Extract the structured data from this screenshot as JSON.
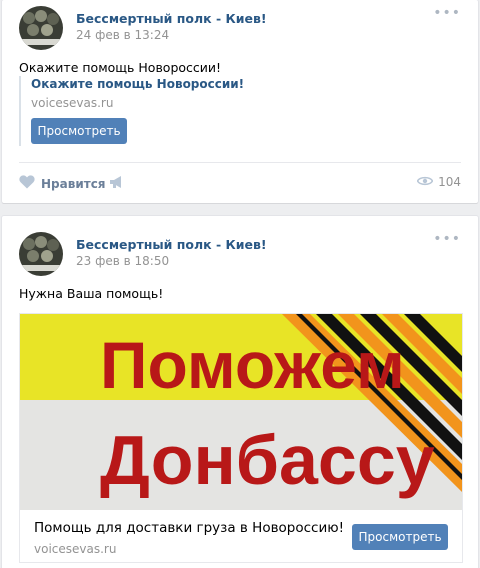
{
  "posts": [
    {
      "author": "Бессмертный полк - Киев!",
      "date": "24 фев в 13:24",
      "more": "•••",
      "text": "Окажите помощь Новороссии!",
      "link": {
        "title": "Окажите помощь Новороссии!",
        "domain": "voicesevas.ru",
        "button": "Просмотреть"
      },
      "like_label": "Нравится",
      "views": "104"
    },
    {
      "author": "Бессмертный полк - Киев!",
      "date": "23 фев в 18:50",
      "more": "•••",
      "text": "Нужна Ваша помощь!",
      "snippet": {
        "image_words": [
          "Поможем",
          "Донбассу"
        ],
        "title": "Помощь для доставки груза в Новороссию!",
        "domain": "voicesevas.ru",
        "button": "Просмотреть"
      }
    }
  ],
  "icons": {
    "like": "heart-icon",
    "share": "megaphone-icon",
    "views": "eye-icon",
    "more": "more-dots-icon"
  },
  "colors": {
    "link": "#2a5885",
    "button": "#5181b8",
    "banner_red": "#b81818",
    "banner_yellow": "#e8e426"
  }
}
